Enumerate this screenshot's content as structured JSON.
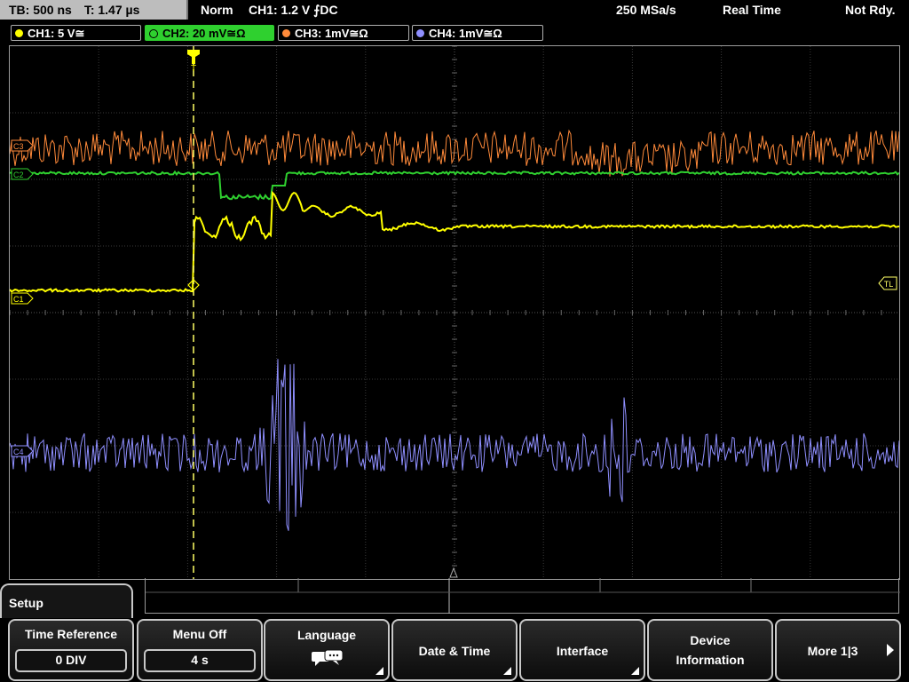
{
  "status": {
    "timebase": "TB: 500 ns",
    "trigger_time": "T: 1.47 µs",
    "mode": "Norm",
    "trigger_setting": "CH1: 1.2 V ⨍DC",
    "sample_rate": "250 MSa/s",
    "acq_mode": "Real Time",
    "state": "Not Rdy."
  },
  "channels": [
    {
      "label": "CH1: 5 V≅",
      "color": "#ffff00"
    },
    {
      "label": "CH2: 20 mV≅Ω",
      "color": "#2fd02f"
    },
    {
      "label": "CH3: 1mV≅Ω",
      "color": "#ff8a3a"
    },
    {
      "label": "CH4: 1mV≅Ω",
      "color": "#8f8fff"
    }
  ],
  "markers": {
    "trigger": "T",
    "trigger_level": "TL",
    "ch1": "C1",
    "ch2": "C2",
    "ch3": "C3",
    "ch4": "C4"
  },
  "menu": {
    "title": "Setup",
    "softkeys": [
      {
        "label": "Time Reference",
        "value": "0 DIV"
      },
      {
        "label": "Menu Off",
        "value": "4 s"
      },
      {
        "label": "Language",
        "icon": "speech-bubbles-icon"
      },
      {
        "label": "Date & Time"
      },
      {
        "label": "Interface"
      },
      {
        "label": "Device",
        "label2": "Information"
      },
      {
        "label": "More 1|3"
      }
    ]
  }
}
